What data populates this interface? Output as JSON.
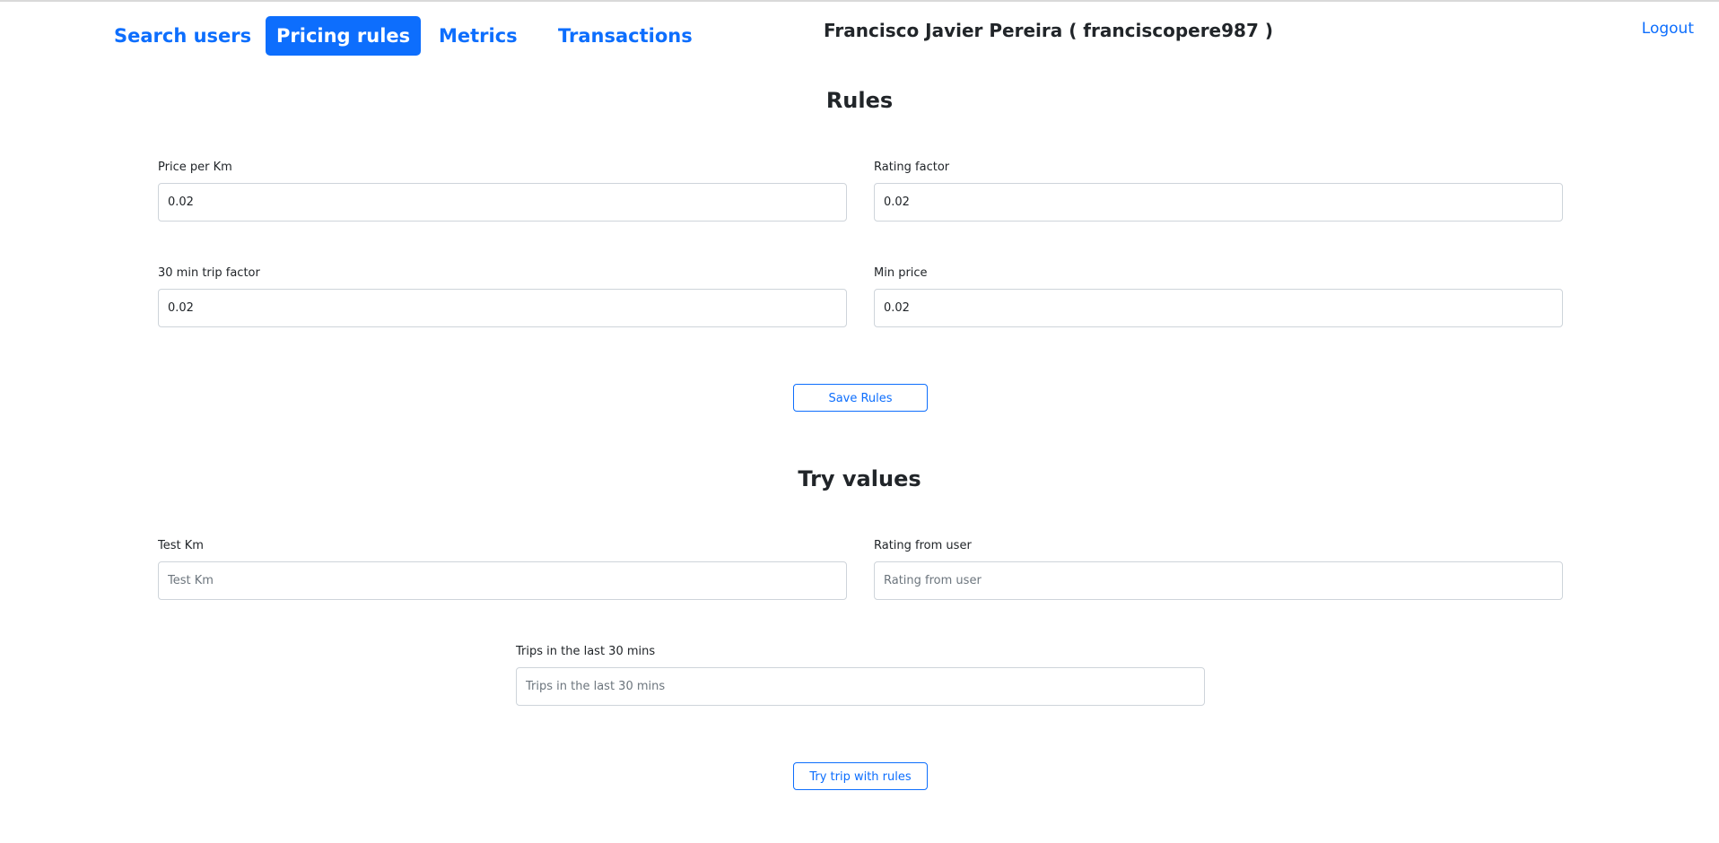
{
  "nav": {
    "items": [
      {
        "label": "Search users",
        "active": false
      },
      {
        "label": "Pricing rules",
        "active": true
      },
      {
        "label": "Metrics",
        "active": false
      },
      {
        "label": "Transactions",
        "active": false
      }
    ],
    "user_title": "Francisco Javier Pereira ( franciscopere987 )",
    "logout_label": "Logout"
  },
  "rules": {
    "title": "Rules",
    "price_per_km": {
      "label": "Price per Km",
      "value": "0.02"
    },
    "rating_factor": {
      "label": "Rating factor",
      "value": "0.02"
    },
    "trip_factor_30min": {
      "label": "30 min trip factor",
      "value": "0.02"
    },
    "min_price": {
      "label": "Min price",
      "value": "0.02"
    },
    "save_label": "Save Rules"
  },
  "try_values": {
    "title": "Try values",
    "test_km": {
      "label": "Test Km",
      "placeholder": "Test Km"
    },
    "rating_from_user": {
      "label": "Rating from user",
      "placeholder": "Rating from user"
    },
    "trips_last_30": {
      "label": "Trips in the last 30 mins",
      "placeholder": "Trips in the last 30 mins"
    },
    "try_label": "Try trip with rules"
  },
  "colors": {
    "accent": "#0d6efd",
    "text": "#212529",
    "border": "#ced4da"
  }
}
